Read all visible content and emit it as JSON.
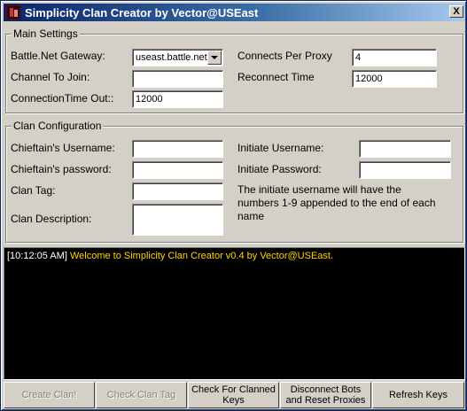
{
  "window": {
    "title": "Simplicity Clan Creator by Vector@USEast",
    "close_label": "X"
  },
  "main_settings": {
    "title": "Main Settings",
    "gateway_label": "Battle.Net Gateway:",
    "gateway_value": "useast.battle.net",
    "channel_label": "Channel To Join:",
    "channel_value": "",
    "timeout_label": "ConnectionTime Out::",
    "timeout_value": "12000",
    "cpp_label": "Connects Per Proxy",
    "cpp_value": "4",
    "reconnect_label": "Reconnect Time",
    "reconnect_value": "12000"
  },
  "clan_config": {
    "title": "Clan Configuration",
    "chieftain_user_label": "Chieftain's Username:",
    "chieftain_user_value": "",
    "chieftain_pass_label": "Chieftain's password:",
    "chieftain_pass_value": "",
    "clan_tag_label": "Clan Tag:",
    "clan_tag_value": "",
    "clan_desc_label": "Clan Description:",
    "clan_desc_value": "",
    "initiate_user_label": "Initiate Username:",
    "initiate_user_value": "",
    "initiate_pass_label": "Initiate Password:",
    "initiate_pass_value": "",
    "note": "The initiate username will have the numbers 1-9 appended to the end of each name"
  },
  "log": {
    "entries": [
      {
        "time": "[10:12:05 AM]",
        "message": "Welcome to Simplicity Clan Creator v0.4 by Vector@USEast."
      }
    ],
    "time_color": "#ffffff",
    "message_color": "#ffd400"
  },
  "buttons": {
    "create_clan": "Create Clan!",
    "check_clan_tag": "Check Clan Tag",
    "check_clanned_keys": "Check For Clanned Keys",
    "disconnect_bots": "Disconnect Bots and Reset Proxies",
    "refresh_keys": "Refresh Keys"
  }
}
